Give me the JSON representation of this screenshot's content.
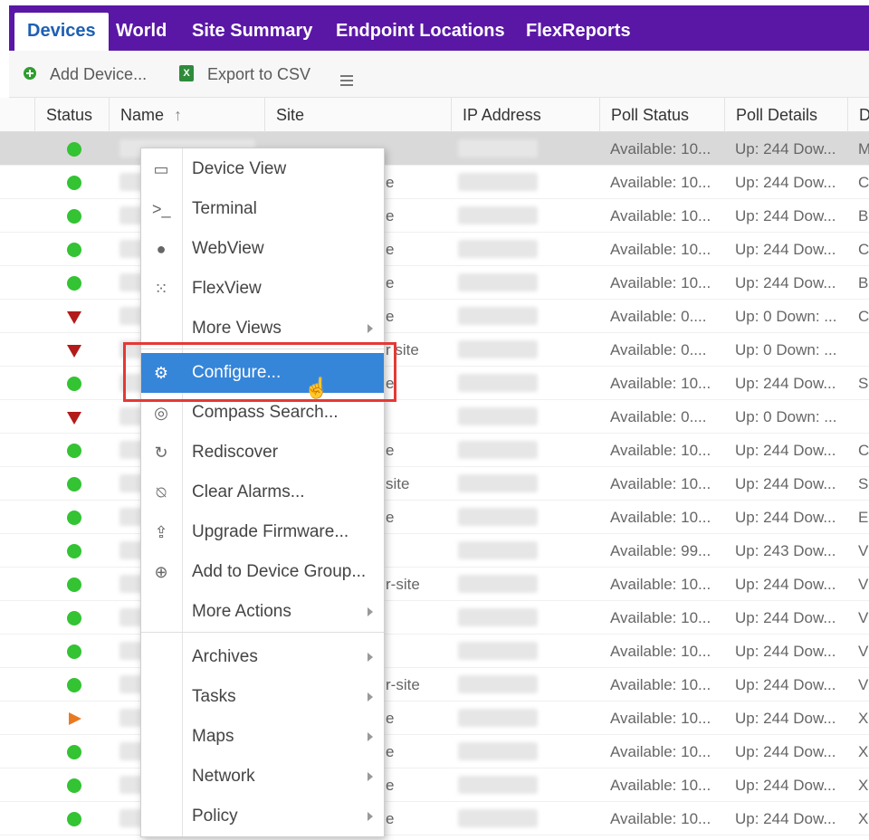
{
  "tabs": [
    {
      "label": "Devices"
    },
    {
      "label": "World"
    },
    {
      "label": "Site Summary"
    },
    {
      "label": "Endpoint Locations"
    },
    {
      "label": "FlexReports"
    }
  ],
  "toolbar": {
    "add_device": "Add Device...",
    "export_csv": "Export to CSV",
    "add_icon": "add-circle-icon",
    "export_icon": "excel-icon",
    "menu_icon": "menu-lines-icon"
  },
  "columns": [
    "Status",
    "Name",
    "Site",
    "IP Address",
    "Poll Status",
    "Poll Details",
    "D"
  ],
  "sort_icon": "sort-up-icon",
  "rows": [
    {
      "status": "up",
      "site_frag": "",
      "poll_status": "Available: 10...",
      "poll_details": "Up: 244 Dow...",
      "d": "M"
    },
    {
      "status": "up",
      "site_frag": "e",
      "poll_status": "Available: 10...",
      "poll_details": "Up: 244 Dow...",
      "d": "C"
    },
    {
      "status": "up",
      "site_frag": "e",
      "poll_status": "Available: 10...",
      "poll_details": "Up: 244 Dow...",
      "d": "B"
    },
    {
      "status": "up",
      "site_frag": "e",
      "poll_status": "Available: 10...",
      "poll_details": "Up: 244 Dow...",
      "d": "C"
    },
    {
      "status": "up",
      "site_frag": "e",
      "poll_status": "Available: 10...",
      "poll_details": "Up: 244 Dow...",
      "d": "B"
    },
    {
      "status": "down",
      "site_frag": "e",
      "poll_status": "Available: 0....",
      "poll_details": "Up: 0 Down: ...",
      "d": "C"
    },
    {
      "status": "down",
      "site_frag": "r site",
      "poll_status": "Available: 0....",
      "poll_details": "Up: 0 Down: ...",
      "d": ""
    },
    {
      "status": "up",
      "site_frag": "e",
      "poll_status": "Available: 10...",
      "poll_details": "Up: 244 Dow...",
      "d": "S"
    },
    {
      "status": "down",
      "site_frag": "",
      "poll_status": "Available: 0....",
      "poll_details": "Up: 0 Down: ...",
      "d": ""
    },
    {
      "status": "up",
      "site_frag": "e",
      "poll_status": "Available: 10...",
      "poll_details": "Up: 244 Dow...",
      "d": "C"
    },
    {
      "status": "up",
      "site_frag": "site",
      "poll_status": "Available: 10...",
      "poll_details": "Up: 244 Dow...",
      "d": "S"
    },
    {
      "status": "up",
      "site_frag": "e",
      "poll_status": "Available: 10...",
      "poll_details": "Up: 244 Dow...",
      "d": "E"
    },
    {
      "status": "up",
      "site_frag": "",
      "poll_status": "Available: 99...",
      "poll_details": "Up: 243 Dow...",
      "d": "V"
    },
    {
      "status": "up",
      "site_frag": "r-site",
      "poll_status": "Available: 10...",
      "poll_details": "Up: 244 Dow...",
      "d": "V"
    },
    {
      "status": "up",
      "site_frag": "",
      "poll_status": "Available: 10...",
      "poll_details": "Up: 244 Dow...",
      "d": "V"
    },
    {
      "status": "up",
      "site_frag": "",
      "poll_status": "Available: 10...",
      "poll_details": "Up: 244 Dow...",
      "d": "V"
    },
    {
      "status": "up",
      "site_frag": "r-site",
      "poll_status": "Available: 10...",
      "poll_details": "Up: 244 Dow...",
      "d": "V"
    },
    {
      "status": "warning",
      "site_frag": "e",
      "poll_status": "Available: 10...",
      "poll_details": "Up: 244 Dow...",
      "d": "X"
    },
    {
      "status": "up",
      "site_frag": "e",
      "poll_status": "Available: 10...",
      "poll_details": "Up: 244 Dow...",
      "d": "X"
    },
    {
      "status": "up",
      "site_frag": "e",
      "poll_status": "Available: 10...",
      "poll_details": "Up: 244 Dow...",
      "d": "X"
    },
    {
      "status": "up",
      "site_frag": "e",
      "poll_status": "Available: 10...",
      "poll_details": "Up: 244 Dow...",
      "d": "X"
    }
  ],
  "context_menu": {
    "items": [
      {
        "label": "Device View",
        "icon": "device-view-icon",
        "glyph": "▭"
      },
      {
        "label": "Terminal",
        "icon": "terminal-icon",
        "glyph": ">_"
      },
      {
        "label": "WebView",
        "icon": "globe-icon",
        "glyph": "●"
      },
      {
        "label": "FlexView",
        "icon": "grid-icon",
        "glyph": "⁙"
      },
      {
        "label": "More Views",
        "icon": "",
        "glyph": ""
      },
      {
        "label": "Configure...",
        "icon": "gear-icon",
        "glyph": "⚙"
      },
      {
        "label": "Compass Search...",
        "icon": "compass-icon",
        "glyph": "◎"
      },
      {
        "label": "Rediscover",
        "icon": "refresh-icon",
        "glyph": "↻"
      },
      {
        "label": "Clear Alarms...",
        "icon": "bell-off-icon",
        "glyph": "⍉"
      },
      {
        "label": "Upgrade Firmware...",
        "icon": "upload-icon",
        "glyph": "⇪"
      },
      {
        "label": "Add to Device Group...",
        "icon": "add-circle-icon",
        "glyph": "⊕"
      },
      {
        "label": "More Actions",
        "icon": "",
        "glyph": ""
      },
      {
        "label": "Archives",
        "icon": "",
        "glyph": ""
      },
      {
        "label": "Tasks",
        "icon": "",
        "glyph": ""
      },
      {
        "label": "Maps",
        "icon": "",
        "glyph": ""
      },
      {
        "label": "Network",
        "icon": "",
        "glyph": ""
      },
      {
        "label": "Policy",
        "icon": "",
        "glyph": ""
      }
    ],
    "highlighted": "Configure..."
  },
  "colors": {
    "tabbar": "#5a17a6",
    "active_tab_text": "#1d5fb4",
    "highlight": "#3585d9",
    "callout_border": "#e53935",
    "status_up": "#33c333",
    "status_down": "#b31a1a",
    "status_warning": "#e87a22"
  }
}
